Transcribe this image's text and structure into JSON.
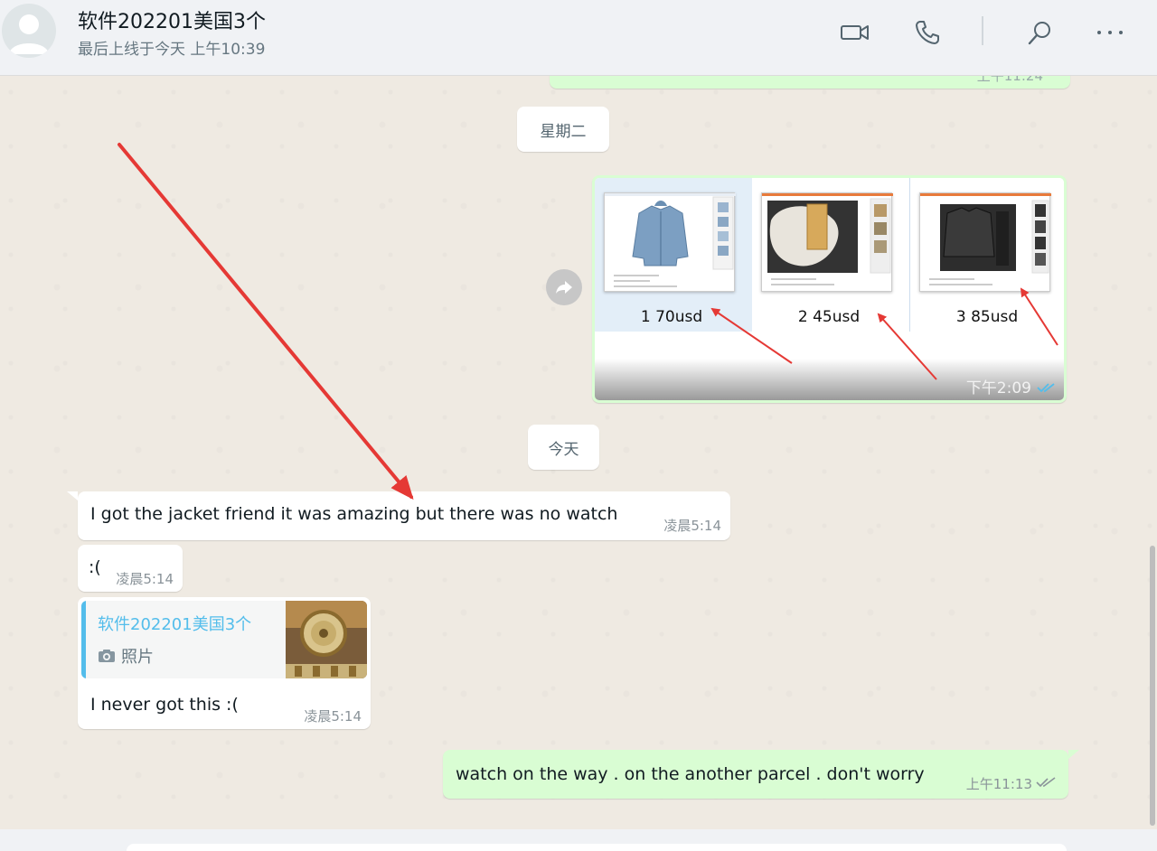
{
  "header": {
    "title": "软件202201美国3个",
    "status": "最后上线于今天 上午10:39",
    "icons": [
      "video-call-icon",
      "voice-call-icon",
      "search-icon",
      "more-icon"
    ]
  },
  "messages": {
    "partial_top_time": "上午11:24",
    "date_tuesday": "星期二",
    "image_grid": {
      "labels": [
        "1  70usd",
        "2  45usd",
        "3   85usd"
      ],
      "time": "下午2:09"
    },
    "date_today": "今天",
    "in1": {
      "text": "I got the jacket friend it was amazing but there was no watch",
      "time": "凌晨5:14"
    },
    "in2": {
      "text": ":(",
      "time": "凌晨5:14"
    },
    "in3": {
      "quote_name": "软件202201美国3个",
      "quote_type": "照片",
      "text": "I never got this :(",
      "time": "凌晨5:14"
    },
    "out_last": {
      "text": "watch on the way . on the another parcel . don't worry",
      "time": "上午11:13"
    }
  },
  "colors": {
    "outgoing": "#d9fdd3",
    "incoming": "#ffffff",
    "annotation_arrow": "#e53935",
    "read_checks": "#53bdeb"
  }
}
